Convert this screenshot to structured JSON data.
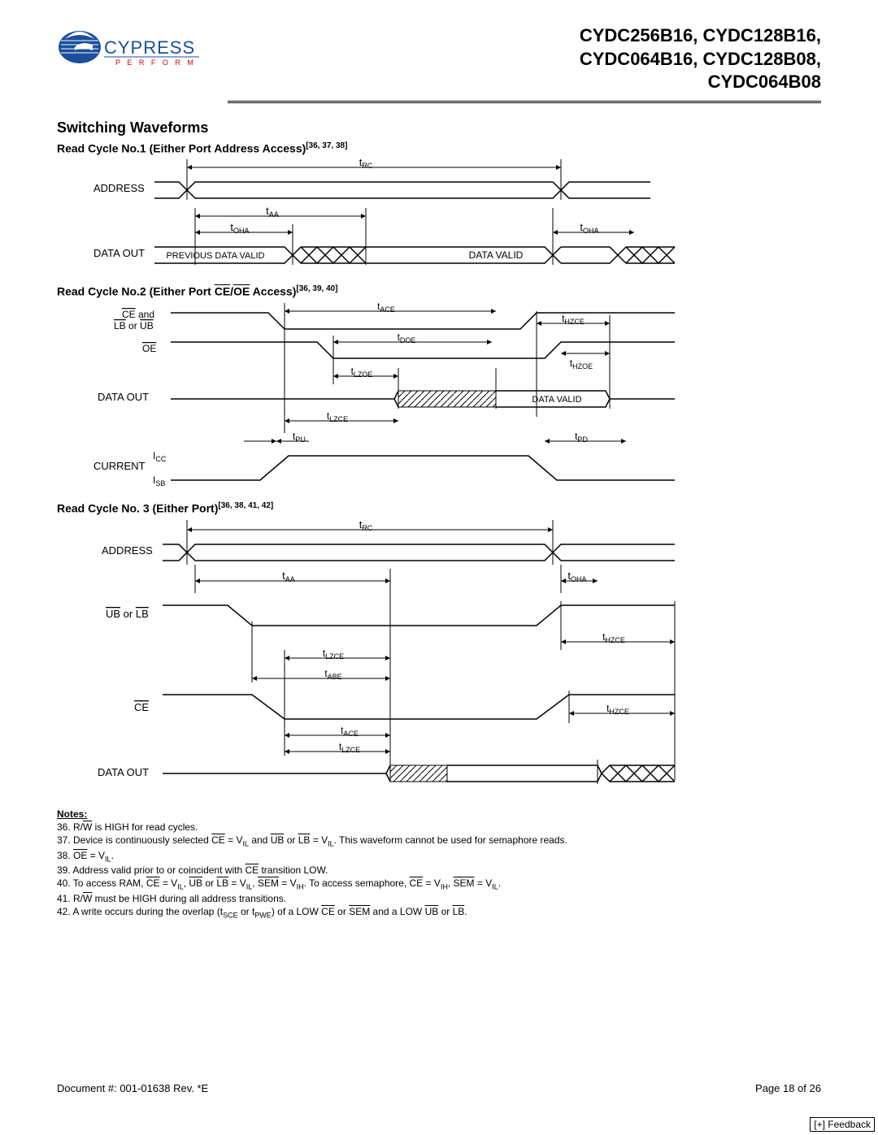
{
  "header": {
    "brand_name": "CYPRESS",
    "brand_tag": "P E R F O R M",
    "parts_line1": "CYDC256B16, CYDC128B16,",
    "parts_line2": "CYDC064B16, CYDC128B08,",
    "parts_line3": "CYDC064B08"
  },
  "section_title": "Switching Waveforms",
  "diagram1": {
    "title_prefix": "Read Cycle No.1 (Either Port Address Access)",
    "title_refs": "[36, 37, 38]",
    "labels": {
      "address": "ADDRESS",
      "data_out": "DATA OUT",
      "previous_data_valid": "PREVIOUS DATA VALID",
      "data_valid": "DATA VALID"
    },
    "timing": {
      "t_rc": "tRC",
      "t_aa": "tAA",
      "t_oha": "tOHA"
    }
  },
  "diagram2": {
    "title_main": "Read Cycle No.2 (Either Port ",
    "title_ce": "CE",
    "title_slash": "/",
    "title_oe": "OE",
    "title_access": " Access)",
    "title_refs": "[36, 39, 40]",
    "labels": {
      "ce_and": "CE and",
      "lb_ub": "LB or UB",
      "oe": "OE",
      "data_out": "DATA OUT",
      "current": "CURRENT",
      "icc": "ICC",
      "isb": "ISB",
      "data_valid": "DATA VALID"
    },
    "timing": {
      "t_ace": "tACE",
      "t_doe": "tDOE",
      "t_lzoe": "tLZOE",
      "t_lzce": "tLZCE",
      "t_pu": "tPU",
      "t_hzce": "tHZCE",
      "t_hzoe": "tHZOE",
      "t_pd": "tPD"
    }
  },
  "diagram3": {
    "title_main": "Read Cycle No. 3 (Either Port)",
    "title_refs": "[36, 38, 41, 42]",
    "labels": {
      "address": "ADDRESS",
      "ub_lb": "UB or LB",
      "ce": "CE",
      "data_out": "DATA OUT"
    },
    "timing": {
      "t_rc": "tRC",
      "t_aa": "tAA",
      "t_oha": "tOHA",
      "t_lzce": "tLZCE",
      "t_abe": "tABE",
      "t_ace": "tACE",
      "t_hzce": "tHZCE"
    }
  },
  "notes": {
    "title": "Notes:",
    "n36_a": "36. R/",
    "n36_b": "W",
    "n36_c": " is HIGH for read cycles.",
    "n37_a": "37. Device is continuously selected ",
    "n37_ce": "CE",
    "n37_b": " = V",
    "n37_il": "IL",
    "n37_c": " and ",
    "n37_ub": "UB",
    "n37_d": " or ",
    "n37_lb": "LB",
    "n37_e": " = V",
    "n37_f": ". This waveform cannot be used for semaphore reads.",
    "n38_a": "38. ",
    "n38_oe": "OE",
    "n38_b": " = V",
    "n38_c": ".",
    "n39_a": "39. Address valid prior to or coincident with ",
    "n39_ce": "CE",
    "n39_b": " transition LOW.",
    "n40_a": "40. To access RAM, ",
    "n40_ce": "CE",
    "n40_b": " = V",
    "n40_c": ", ",
    "n40_ub": "UB",
    "n40_d": " or ",
    "n40_lb": "LB",
    "n40_e": " = V",
    "n40_f": ", ",
    "n40_sem": "SEM",
    "n40_g": " = V",
    "n40_ih": "IH",
    "n40_h": ". To access semaphore, ",
    "n40_i": " = V",
    "n40_j": ", ",
    "n40_k": " = V",
    "n40_l": ".",
    "n41_a": "41. R/",
    "n41_w": "W",
    "n41_b": " must be HIGH during all address transitions.",
    "n42_a": "42. A write occurs during the overlap (t",
    "n42_sce": "SCE",
    "n42_b": " or t",
    "n42_pwe": "PWE",
    "n42_c": ") of a LOW ",
    "n42_ce": "CE",
    "n42_d": " or ",
    "n42_sem": "SEM",
    "n42_e": " and a LOW ",
    "n42_ub": "UB",
    "n42_f": " or ",
    "n42_lb": "LB",
    "n42_g": "."
  },
  "footer": {
    "docnum": "Document #: 001-01638 Rev. *E",
    "page": "Page 18 of 26"
  },
  "feedback": "[+] Feedback"
}
